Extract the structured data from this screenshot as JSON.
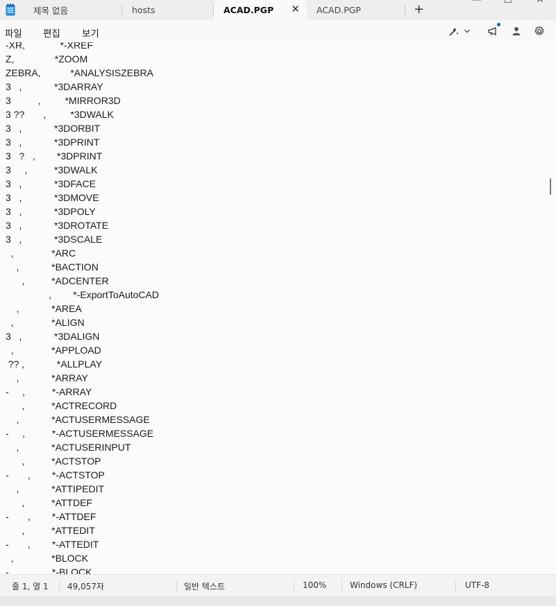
{
  "tabs": [
    {
      "label": "제목 없음"
    },
    {
      "label": "hosts"
    },
    {
      "label": "ACAD.PGP"
    },
    {
      "label": "ACAD.PGP"
    }
  ],
  "tab_close_glyph": "✕",
  "new_tab_glyph": "+",
  "window": {
    "minimize": "—",
    "maximize": "☐",
    "close": "✕"
  },
  "menu": {
    "file": "파일",
    "edit": "편집",
    "view": "보기"
  },
  "toolbar_icons": [
    "copilot-icon",
    "chevron-down-icon",
    "megaphone-icon",
    "account-icon",
    "gear-icon"
  ],
  "accent_color": "#0067c0",
  "editor_lines": [
    "-XR,             *-XREF",
    "Z,               *ZOOM",
    "ZEBRA,           *ANALYSISZEBRA",
    "3   ,            *3DARRAY",
    "3          ,         *MIRROR3D",
    "3 ??       ,         *3DWALK",
    "3   ,            *3DORBIT",
    "3   ,            *3DPRINT",
    "3   ?   ,        *3DPRINT",
    "3     ,          *3DWALK",
    "3   ,            *3DFACE",
    "3   ,            *3DMOVE",
    "3   ,            *3DPOLY",
    "3   ,            *3DROTATE",
    "3   ,            *3DSCALE",
    "  ,              *ARC",
    "    ,            *BACTION",
    "      ,          *ADCENTER",
    "                ,        *-ExportToAutoCAD",
    "    ,            *AREA",
    "  ,              *ALIGN",
    "3   ,            *3DALIGN",
    "  ,              *APPLOAD",
    " ?? ,            *ALLPLAY",
    "    ,            *ARRAY",
    "-     ,          *-ARRAY",
    "      ,          *ACTRECORD",
    "    ,            *ACTUSERMESSAGE",
    "-     ,          *-ACTUSERMESSAGE",
    "    ,            *ACTUSERINPUT",
    "      ,          *ACTSTOP",
    "-       ,        *-ACTSTOP",
    "    ,            *ATTIPEDIT",
    "      ,          *ATTDEF",
    "-       ,        *-ATTDEF",
    "      ,          *ATTEDIT",
    "-       ,        *-ATTEDIT",
    "  ,              *BLOCK",
    "-                *-BLOCK"
  ],
  "status": {
    "position": "줄 1, 열 1",
    "chars": "49,057자",
    "mode": "일반 텍스트",
    "zoom": "100%",
    "line_ending": "Windows (CRLF)",
    "encoding": "UTF-8"
  }
}
